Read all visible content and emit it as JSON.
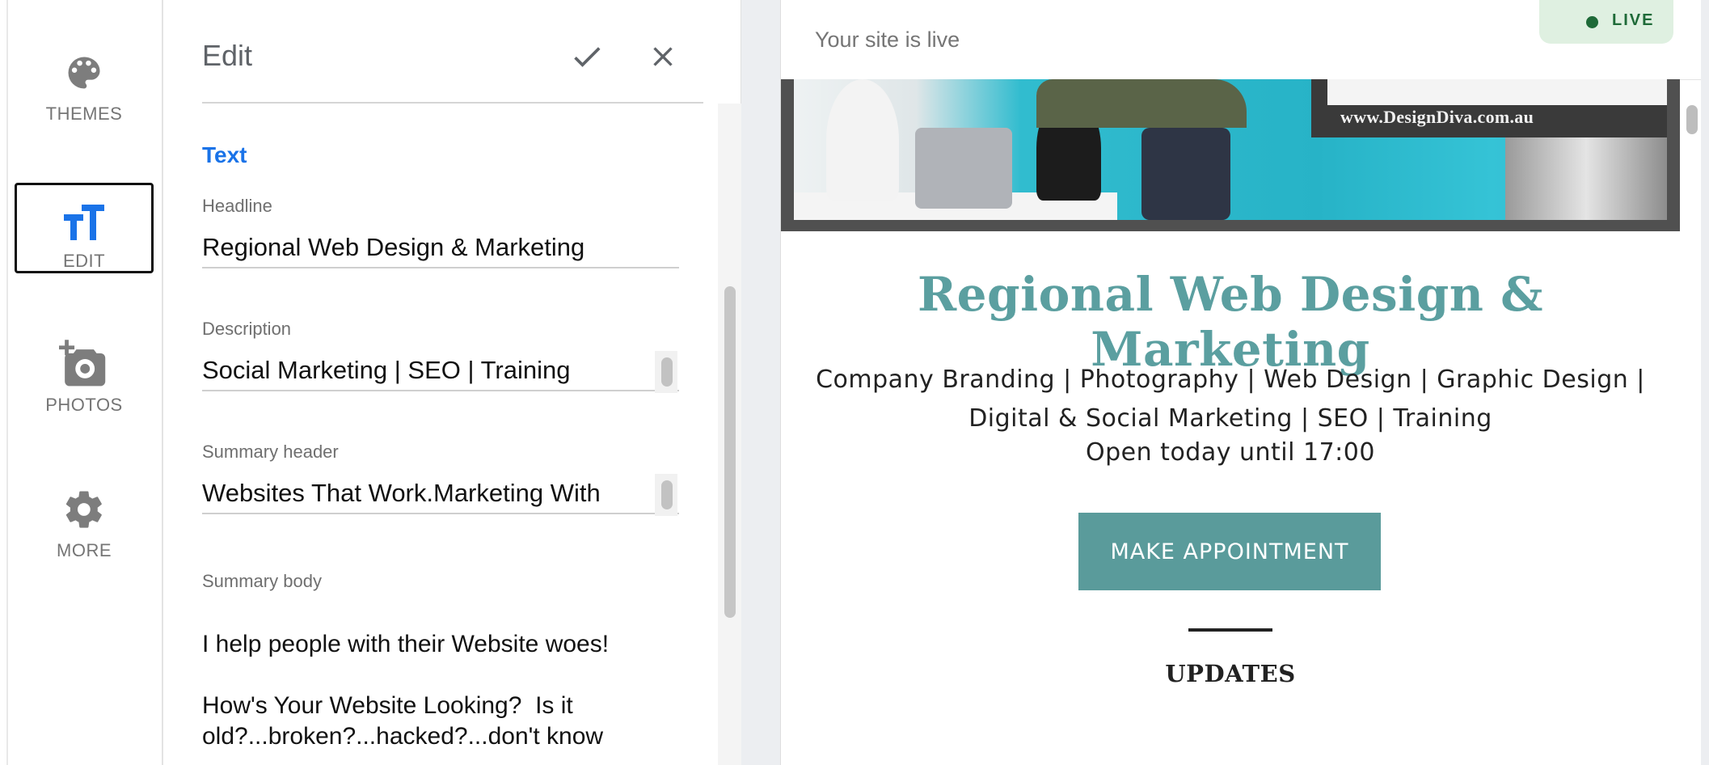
{
  "nav": {
    "items": [
      {
        "label": "THEMES",
        "icon": "palette-icon"
      },
      {
        "label": "EDIT",
        "icon": "text-format-icon",
        "active": true
      },
      {
        "label": "PHOTOS",
        "icon": "add-photo-icon"
      },
      {
        "label": "MORE",
        "icon": "gear-icon"
      }
    ]
  },
  "panel": {
    "title": "Edit",
    "section": "Text",
    "fields": {
      "headline": {
        "label": "Headline",
        "value": "Regional Web Design & Marketing"
      },
      "description": {
        "label": "Description",
        "value": "Social Marketing | SEO | Training"
      },
      "summary_header": {
        "label": "Summary header",
        "value": "Websites That Work.Marketing With"
      },
      "summary_body": {
        "label": "Summary body",
        "value": "I help people with their Website woes!\n\nHow's Your Website Looking?  Is it old?...broken?...hacked?...don't know"
      }
    }
  },
  "preview": {
    "status_text": "Your site is live",
    "badge": "LIVE",
    "hero_url": "www.DesignDiva.com.au",
    "site_title": "Regional Web Design & Marketing",
    "site_description": "Company Branding | Photography | Web Design | Graphic Design | Digital & Social Marketing | SEO | Training",
    "hours": "Open today until 17:00",
    "cta_label": "MAKE APPOINTMENT",
    "updates_heading": "UPDATES"
  },
  "colors": {
    "accent_blue": "#1a73e8",
    "brand_teal": "#5b9fa0",
    "button_teal": "#5a9b9b",
    "live_green": "#1e6a38",
    "live_bg": "#dff0e1"
  }
}
